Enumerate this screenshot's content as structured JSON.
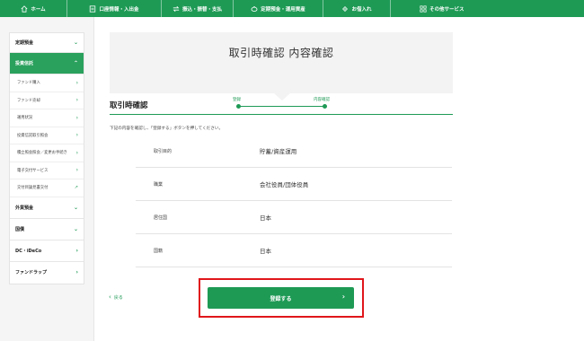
{
  "nav": {
    "items": [
      {
        "label": "ホーム",
        "icon": "home-icon"
      },
      {
        "label": "口座情報・入出金",
        "icon": "bankbook-icon"
      },
      {
        "label": "振込・振替・支払",
        "icon": "transfer-icon"
      },
      {
        "label": "定期預金・運用資産",
        "icon": "piggy-bank-icon"
      },
      {
        "label": "お借入れ",
        "icon": "loan-icon"
      },
      {
        "label": "その他サービス",
        "icon": "grid-icon"
      }
    ]
  },
  "sidebar": {
    "sections": [
      {
        "label": "定期預金",
        "active": false
      },
      {
        "label": "投資信託",
        "active": true
      },
      {
        "label": "外貨預金",
        "active": false
      },
      {
        "label": "国債",
        "active": false
      },
      {
        "label": "DC・iDeCo",
        "active": false
      },
      {
        "label": "ファンドラップ",
        "active": false
      }
    ],
    "sub_items": [
      {
        "label": "ファンド購入"
      },
      {
        "label": "ファンド売却"
      },
      {
        "label": "運用状況"
      },
      {
        "label": "投資信託取引照会"
      },
      {
        "label": "積立照会照会／変更お手続き"
      },
      {
        "label": "電子交付サービス"
      },
      {
        "label": "交付目論見書交付"
      }
    ]
  },
  "steps": {
    "title": "取引時確認 内容確認",
    "step1": "登録",
    "step2": "内容確認"
  },
  "section": {
    "title": "取引時確認",
    "instruction": "下記の内容を確認し、「登録する」ボタンを押してください。"
  },
  "rows": [
    {
      "label": "取引目的",
      "value": "貯蓄/資産運用"
    },
    {
      "label": "職業",
      "value": "会社役員/団体役員"
    },
    {
      "label": "居住国",
      "value": "日本"
    },
    {
      "label": "国籍",
      "value": "日本"
    }
  ],
  "actions": {
    "back": "戻る",
    "register": "登録する"
  },
  "colors": {
    "brand_green": "#1e9a55",
    "highlight_red": "#e0161b"
  }
}
